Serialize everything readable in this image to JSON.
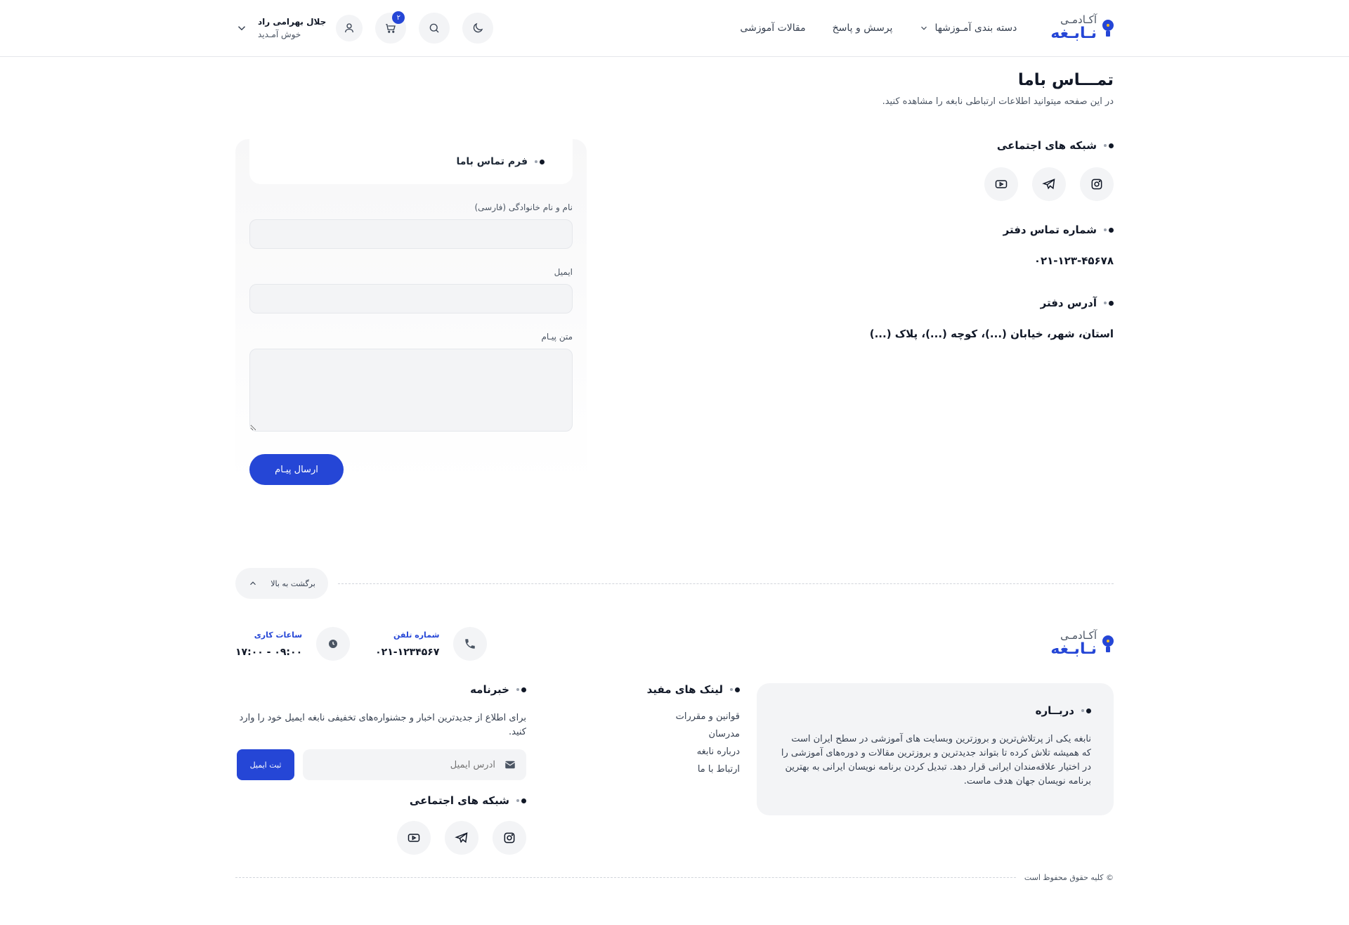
{
  "header": {
    "logo_small": "آکـادمـی",
    "logo_big": "نـابـغه",
    "nav": [
      "دسته بندی آمـوزشها",
      "پرسش و پاسخ",
      "مقالات آموزشی"
    ],
    "cart_count": "۲",
    "user_name": "جلال بهرامی راد",
    "user_welcome": "خوش آمـدید"
  },
  "page": {
    "title": "تمـــاس باما",
    "subtitle": "در این صفحه میتوانید اطلاعات ارتباطی نابغه را مشاهده کنید."
  },
  "contact_info": {
    "social_title": "شبکه های اجتماعی",
    "phone_title": "شماره تماس دفتر",
    "phone_value": "۰۲۱-۱۲۳-۴۵۶۷۸",
    "address_title": "آدرس دفتر",
    "address_value": "استان، شهر، خیابان (...)، کوچه (...)، پلاک (...)"
  },
  "form": {
    "title": "فرم تماس باما",
    "name_label": "نام و نام خانوادگی (فارسی)",
    "email_label": "ایمیل",
    "message_label": "متن پیـام",
    "name_value": "",
    "email_value": "",
    "message_value": "",
    "submit": "ارسال پیـام"
  },
  "footer": {
    "back_to_top": "برگشت به بالا",
    "logo_small": "آکـادمـی",
    "logo_big": "نـابـغه",
    "phone_label": "شماره تلفن",
    "phone_value": "۰۲۱-۱۲۳۴۵۶۷",
    "hours_label": "ساعات کاری",
    "hours_value": "۰۹:۰۰ - ۱۷:۰۰",
    "about_title": "دربــاره",
    "about_text": "نابغه یکی از پرتلاش‌ترین و بروزترین وبسایت های آموزشی در سطح ایران است که همیشه تلاش کرده تا بتواند جدیدترین و بروزترین مقالات و دوره‌های آموزشی را در اختیار علاقه‌مندان ایرانی قرار دهد. تبدیل کردن برنامه نویسان ایرانی به بهترین برنامه نویسان جهان هدف ماست.",
    "links_title": "لینک های مفید",
    "links": [
      "قوانین و مقررات",
      "مدرسان",
      "درباره نابغه",
      "ارتباط با ما"
    ],
    "news_title": "خبرنامه",
    "news_text": "برای اطلاع از جدیدترین اخبار و جشنواره‌های تخفیفی نابغه ایمیل خود را وارد کنید.",
    "news_placeholder": "آدرس ایمیل",
    "news_submit": "ثبت ایمیل",
    "social_title": "شبکه های اجتماعی",
    "copyright": "© کلیه حقوق محفوظ است"
  },
  "colors": {
    "accent": "#2546d6",
    "surface": "#f3f4f6"
  },
  "icons": [
    "logo-bulb-icon",
    "chevron-down-icon",
    "moon-icon",
    "search-icon",
    "cart-icon",
    "user-icon",
    "instagram-icon",
    "telegram-icon",
    "youtube-icon",
    "phone-icon",
    "clock-icon",
    "mail-icon",
    "chevron-up-icon"
  ]
}
